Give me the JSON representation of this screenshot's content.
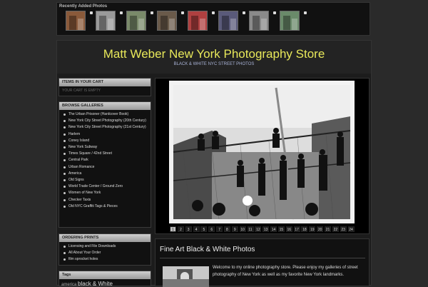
{
  "recent": {
    "title": "Recently Added Photos",
    "thumbs": [
      {
        "name": "thumb-1",
        "tone": "#8a5a3a"
      },
      {
        "name": "thumb-2",
        "tone": "#9a9a9a"
      },
      {
        "name": "thumb-3",
        "tone": "#7a8a6a"
      },
      {
        "name": "thumb-4",
        "tone": "#6a5a4a"
      },
      {
        "name": "thumb-5",
        "tone": "#b04040"
      },
      {
        "name": "thumb-6",
        "tone": "#5a5a7a"
      },
      {
        "name": "thumb-7",
        "tone": "#8a8a8a"
      },
      {
        "name": "thumb-8",
        "tone": "#6a8a6a"
      }
    ]
  },
  "header": {
    "title": "Matt Weber New York Photography Store",
    "subtitle": "BLACK & WHITE NYC STREET PHOTOS"
  },
  "cart": {
    "heading": "ITEMS IN YOUR CART",
    "empty": "YOUR CART IS EMPTY"
  },
  "browse": {
    "heading": "BROWSE GALLERIES",
    "items": [
      "The Urban Prisoner (Hardcover Book)",
      "New York City Street Photography (20th Century)",
      "New York City Street Photography (21st Century)",
      "Harlem",
      "Coney Island",
      "New York Subway",
      "Times Square / 42nd Street",
      "Central Park",
      "Urban Romance",
      "America",
      "Old Signs",
      "World Trade Center / Ground Zero",
      "Women of New York",
      "Checker Taxis",
      "Old NYC Graffiti Tags & Pieces"
    ]
  },
  "ordering": {
    "heading": "ORDERING PRINTS",
    "items": [
      "Licensing and File Downloads",
      "All About Your Order",
      "film sprocket holes"
    ]
  },
  "tags": {
    "heading": "Tags",
    "small": "america",
    "big": "black & White"
  },
  "gallery": {
    "pages": [
      "1",
      "2",
      "3",
      "4",
      "5",
      "6",
      "7",
      "8",
      "9",
      "10",
      "11",
      "12",
      "13",
      "14",
      "15",
      "16",
      "17",
      "18",
      "19",
      "20",
      "21",
      "22",
      "23",
      "24"
    ],
    "current": "1"
  },
  "fine": {
    "heading": "Fine Art Black & White Photos",
    "text": "Welcome to my online photography store. Please enjoy my galleries of street photography of New York as well as my favorite New York landmarks."
  }
}
